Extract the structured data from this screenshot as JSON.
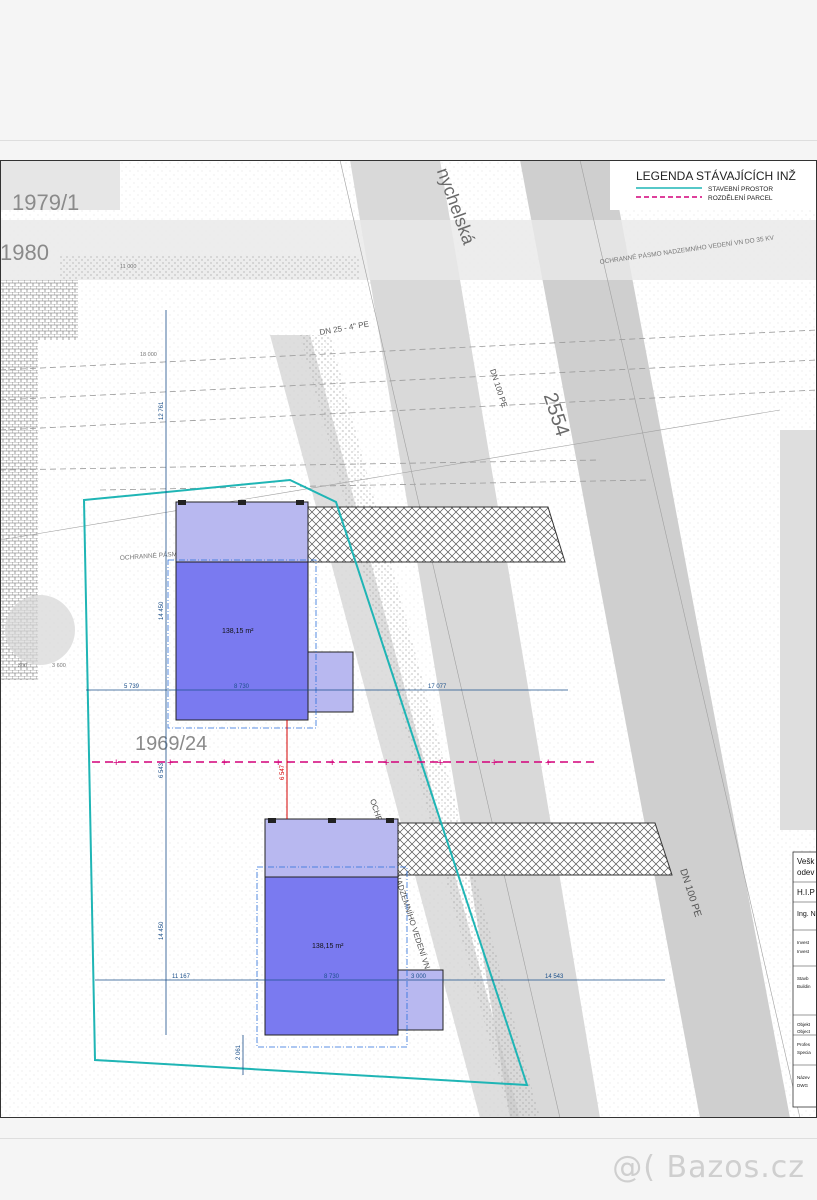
{
  "parcels": {
    "p1": "1979/1",
    "p2": "1980",
    "p3": "1969/24",
    "p4": "2554"
  },
  "street": "nychelská",
  "legend": {
    "title": "LEGENDA STÁVAJÍCÍCH INŽ",
    "items": [
      {
        "label": "STAVEBNÍ PROSTOR",
        "color": "#1fb5b5"
      },
      {
        "label": "ROZDĚLENÍ PARCEL",
        "color": "#d4007a"
      }
    ]
  },
  "annotations": {
    "ochranne_top": "OCHRANNÉ PÁSMO NADZEMNÍHO VEDENÍ VN DO 35 KV",
    "ochranne_mid": "OCHRANNÉ PÁSMO NADZEMNÍHO VEDENÍ VN DO 3",
    "dn_pipe_1": "DN 25 - 4\" PE",
    "dn_pipe_2": "DN 100 PE",
    "dn_pipe_3": "DN 100 PE",
    "vertical_1": "OCHRANNÉ PÁSMO NADZEMNÍHO VEDENÍ VN DO 22 KV"
  },
  "buildings": [
    {
      "area": "138,15 m²"
    },
    {
      "area": "138,15 m²"
    }
  ],
  "dimensions": {
    "d_12761": "12 761",
    "d_14450a": "14 450",
    "d_5739": "5 739",
    "d_8730a": "8 730",
    "d_17077": "17 077",
    "d_6543": "6 543",
    "d_6547": "6 547",
    "d_14450b": "14 450",
    "d_11167": "11 167",
    "d_8730b": "8 730",
    "d_3000": "3 000",
    "d_14543": "14 543",
    "d_2061": "2 061",
    "d_11000": "11 000",
    "d_18000": "18 000",
    "d_3600": "3 600",
    "d_300": "300"
  },
  "title_block": {
    "r1": "Vešk",
    "r2": "odev",
    "r3": "H.I.P",
    "r4": "Ing. N",
    "r5": "Invest",
    "r6": "Invest",
    "r7": "Stavb",
    "r8": "Buildin",
    "r9": "Objekt",
    "r10": "Object",
    "r11": "Profes",
    "r12": "Specia",
    "r13": "Název",
    "r14": "DWG"
  },
  "watermark": "@( Bazos.cz"
}
